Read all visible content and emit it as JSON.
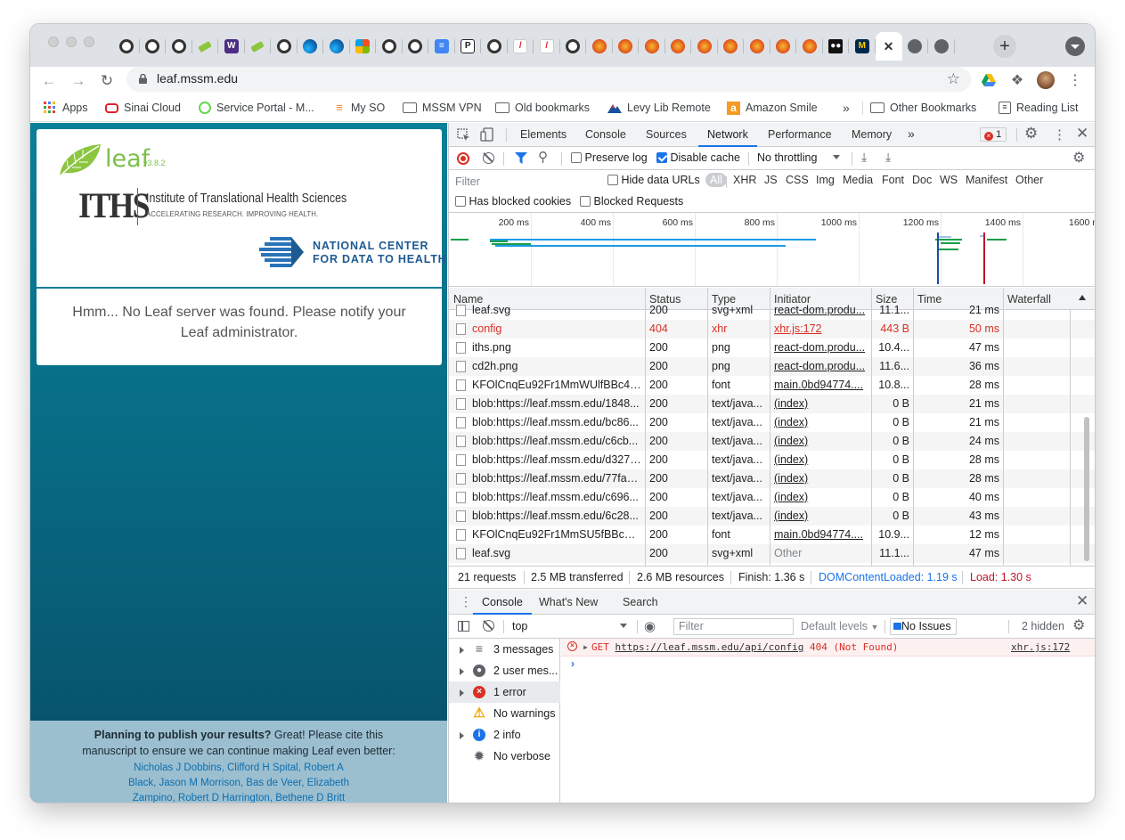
{
  "browser": {
    "url": "leaf.mssm.edu",
    "tabs": [
      {
        "icon": "github-icon",
        "kind": "gh"
      },
      {
        "icon": "github-icon",
        "kind": "gh"
      },
      {
        "icon": "github-icon",
        "kind": "gh"
      },
      {
        "icon": "leaf-icon",
        "kind": "leaf"
      },
      {
        "icon": "w-icon",
        "kind": "w"
      },
      {
        "icon": "leaf-icon",
        "kind": "leaf"
      },
      {
        "icon": "github-icon",
        "kind": "gh"
      },
      {
        "icon": "edge-icon",
        "kind": "edge"
      },
      {
        "icon": "edge-icon",
        "kind": "edge"
      },
      {
        "icon": "microsoft-icon",
        "kind": "ms"
      },
      {
        "icon": "github-icon",
        "kind": "gh"
      },
      {
        "icon": "github-icon",
        "kind": "gh"
      },
      {
        "icon": "docs-icon",
        "kind": "docs"
      },
      {
        "icon": "p-icon",
        "kind": "p"
      },
      {
        "icon": "github-icon",
        "kind": "gh"
      },
      {
        "icon": "pdf-icon",
        "kind": "pdf"
      },
      {
        "icon": "pdf-icon",
        "kind": "pdf"
      },
      {
        "icon": "github-icon",
        "kind": "gh"
      },
      {
        "icon": "fox-icon",
        "kind": "fox"
      },
      {
        "icon": "fox-icon",
        "kind": "fox"
      },
      {
        "icon": "fox-icon",
        "kind": "fox"
      },
      {
        "icon": "fox-icon",
        "kind": "fox"
      },
      {
        "icon": "fox-icon",
        "kind": "fox"
      },
      {
        "icon": "fox-icon",
        "kind": "fox"
      },
      {
        "icon": "fox-icon",
        "kind": "fox"
      },
      {
        "icon": "fox-icon",
        "kind": "fox"
      },
      {
        "icon": "fox-icon",
        "kind": "fox"
      },
      {
        "icon": "medium-icon",
        "kind": "med"
      },
      {
        "icon": "michigan-icon",
        "kind": "mich"
      },
      {
        "icon": "close-icon",
        "kind": "active"
      },
      {
        "icon": "globe-icon",
        "kind": "globe"
      },
      {
        "icon": "globe-icon",
        "kind": "globe"
      }
    ],
    "new_tab": "+",
    "bookmarks": [
      {
        "label": "Apps",
        "icon": "apps-grid-icon"
      },
      {
        "label": "Sinai Cloud",
        "icon": "oracle-icon"
      },
      {
        "label": "Service Portal - M...",
        "icon": "servicenow-icon"
      },
      {
        "label": "My SO",
        "icon": "stackoverflow-icon"
      },
      {
        "label": "MSSM VPN",
        "icon": "folder-icon"
      },
      {
        "label": "Old bookmarks",
        "icon": "folder-icon"
      },
      {
        "label": "Levy Lib Remote",
        "icon": "mountain-icon"
      },
      {
        "label": "Amazon Smile",
        "icon": "amazon-icon"
      }
    ],
    "more": "»",
    "other_bookmarks": "Other Bookmarks",
    "reading_list": "Reading List"
  },
  "leaf_page": {
    "logo_text": "leaf",
    "version": "v3.8.2",
    "iths_abbr": "ITHS",
    "iths_name": "Institute of Translational Health Sciences",
    "iths_tagline": "ACCELERATING RESEARCH. IMPROVING HEALTH.",
    "nc_line1": "NATIONAL CENTER",
    "nc_line2": "FOR DATA TO HEALTH",
    "message": "Hmm... No Leaf server was found. Please notify your Leaf administrator.",
    "cite_bold": "Planning to publish your results?",
    "cite_text": " Great! Please cite this manuscript to ensure we can continue making Leaf even better:",
    "authors": "Nicholas J Dobbins, Clifford H Spital, Robert A Black, Jason M Morrison, Bas de Veer, Elizabeth Zampino, Robert D Harrington, Bethene D Britt"
  },
  "devtools": {
    "tabs": [
      "Elements",
      "Console",
      "Sources",
      "Network",
      "Performance",
      "Memory"
    ],
    "active_tab": "Network",
    "more_tabs": "»",
    "error_count": "1",
    "preserve_log": "Preserve log",
    "disable_cache": "Disable cache",
    "throttling": "No throttling",
    "filter_placeholder": "Filter",
    "hide_data_urls": "Hide data URLs",
    "types": [
      "All",
      "XHR",
      "JS",
      "CSS",
      "Img",
      "Media",
      "Font",
      "Doc",
      "WS",
      "Manifest",
      "Other"
    ],
    "has_blocked_cookies": "Has blocked cookies",
    "blocked_requests": "Blocked Requests",
    "timeline_ticks": [
      "200 ms",
      "400 ms",
      "600 ms",
      "800 ms",
      "1000 ms",
      "1200 ms",
      "1400 ms",
      "1600 ms"
    ],
    "columns": [
      "Name",
      "Status",
      "Type",
      "Initiator",
      "Size",
      "Time",
      "Waterfall"
    ],
    "rows": [
      {
        "name": "leaf.svg",
        "status": "200",
        "type": "svg+xml",
        "initiator": "react-dom.produ...",
        "size": "11.1...",
        "time": "21 ms",
        "error": false,
        "link": true
      },
      {
        "name": "config",
        "status": "404",
        "type": "xhr",
        "initiator": "xhr.js:172",
        "size": "443 B",
        "time": "50 ms",
        "error": true,
        "link": true
      },
      {
        "name": "iths.png",
        "status": "200",
        "type": "png",
        "initiator": "react-dom.produ...",
        "size": "10.4...",
        "time": "47 ms",
        "error": false,
        "link": true
      },
      {
        "name": "cd2h.png",
        "status": "200",
        "type": "png",
        "initiator": "react-dom.produ...",
        "size": "11.6...",
        "time": "36 ms",
        "error": false,
        "link": true
      },
      {
        "name": "KFOlCnqEu92Fr1MmWUlfBBc4A...",
        "status": "200",
        "type": "font",
        "initiator": "main.0bd94774....",
        "size": "10.8...",
        "time": "28 ms",
        "error": false,
        "link": true
      },
      {
        "name": "blob:https://leaf.mssm.edu/1848...",
        "status": "200",
        "type": "text/java...",
        "initiator": "(index)",
        "size": "0 B",
        "time": "21 ms",
        "error": false,
        "link": true
      },
      {
        "name": "blob:https://leaf.mssm.edu/bc86...",
        "status": "200",
        "type": "text/java...",
        "initiator": "(index)",
        "size": "0 B",
        "time": "21 ms",
        "error": false,
        "link": true
      },
      {
        "name": "blob:https://leaf.mssm.edu/c6cb...",
        "status": "200",
        "type": "text/java...",
        "initiator": "(index)",
        "size": "0 B",
        "time": "24 ms",
        "error": false,
        "link": true
      },
      {
        "name": "blob:https://leaf.mssm.edu/d327f...",
        "status": "200",
        "type": "text/java...",
        "initiator": "(index)",
        "size": "0 B",
        "time": "28 ms",
        "error": false,
        "link": true
      },
      {
        "name": "blob:https://leaf.mssm.edu/77fa5...",
        "status": "200",
        "type": "text/java...",
        "initiator": "(index)",
        "size": "0 B",
        "time": "28 ms",
        "error": false,
        "link": true
      },
      {
        "name": "blob:https://leaf.mssm.edu/c696...",
        "status": "200",
        "type": "text/java...",
        "initiator": "(index)",
        "size": "0 B",
        "time": "40 ms",
        "error": false,
        "link": true
      },
      {
        "name": "blob:https://leaf.mssm.edu/6c28...",
        "status": "200",
        "type": "text/java...",
        "initiator": "(index)",
        "size": "0 B",
        "time": "43 ms",
        "error": false,
        "link": true
      },
      {
        "name": "KFOlCnqEu92Fr1MmSU5fBBc4A...",
        "status": "200",
        "type": "font",
        "initiator": "main.0bd94774....",
        "size": "10.9...",
        "time": "12 ms",
        "error": false,
        "link": true
      },
      {
        "name": "leaf.svg",
        "status": "200",
        "type": "svg+xml",
        "initiator": "Other",
        "size": "11.1...",
        "time": "47 ms",
        "error": false,
        "link": false
      }
    ],
    "summary": {
      "requests": "21 requests",
      "transferred": "2.5 MB transferred",
      "resources": "2.6 MB resources",
      "finish": "Finish: 1.36 s",
      "dcl": "DOMContentLoaded: 1.19 s",
      "load": "Load: 1.30 s"
    },
    "drawer_tabs": [
      "Console",
      "What's New",
      "Search"
    ],
    "context": "top",
    "console_filter": "Filter",
    "levels": "Default levels",
    "no_issues": "No Issues",
    "hidden": "2 hidden",
    "sidebar": [
      {
        "label": "3 messages",
        "icon": "list-icon",
        "arrow": true
      },
      {
        "label": "2 user mes...",
        "icon": "user-icon",
        "arrow": true
      },
      {
        "label": "1 error",
        "icon": "error-icon",
        "arrow": true
      },
      {
        "label": "No warnings",
        "icon": "warning-icon",
        "arrow": false
      },
      {
        "label": "2 info",
        "icon": "info-icon",
        "arrow": true
      },
      {
        "label": "No verbose",
        "icon": "bug-icon",
        "arrow": false
      }
    ],
    "error_msg": {
      "method": "GET",
      "url": "https://leaf.mssm.edu/api/config",
      "status": "404 (Not Found)",
      "source": "xhr.js:172"
    }
  }
}
